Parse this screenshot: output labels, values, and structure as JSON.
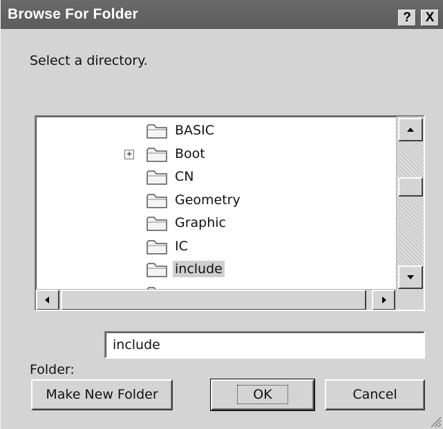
{
  "window": {
    "title": "Browse For Folder",
    "help_label": "?",
    "close_label": "X"
  },
  "prompt": "Select a directory.",
  "tree": {
    "items": [
      {
        "label": "BASIC",
        "expander": ""
      },
      {
        "label": "Boot",
        "expander": "+"
      },
      {
        "label": "CN",
        "expander": ""
      },
      {
        "label": "Geometry",
        "expander": ""
      },
      {
        "label": "Graphic",
        "expander": ""
      },
      {
        "label": "IC",
        "expander": ""
      },
      {
        "label": "include",
        "expander": "",
        "selected": true
      }
    ]
  },
  "folder": {
    "label": "Folder:",
    "value": "include"
  },
  "buttons": {
    "make_new_folder": "Make New Folder",
    "ok": "OK",
    "cancel": "Cancel"
  },
  "colors": {
    "titlebar": "#5c5c5c",
    "face": "#d4d4d4",
    "selection": "#cfcfcf"
  }
}
